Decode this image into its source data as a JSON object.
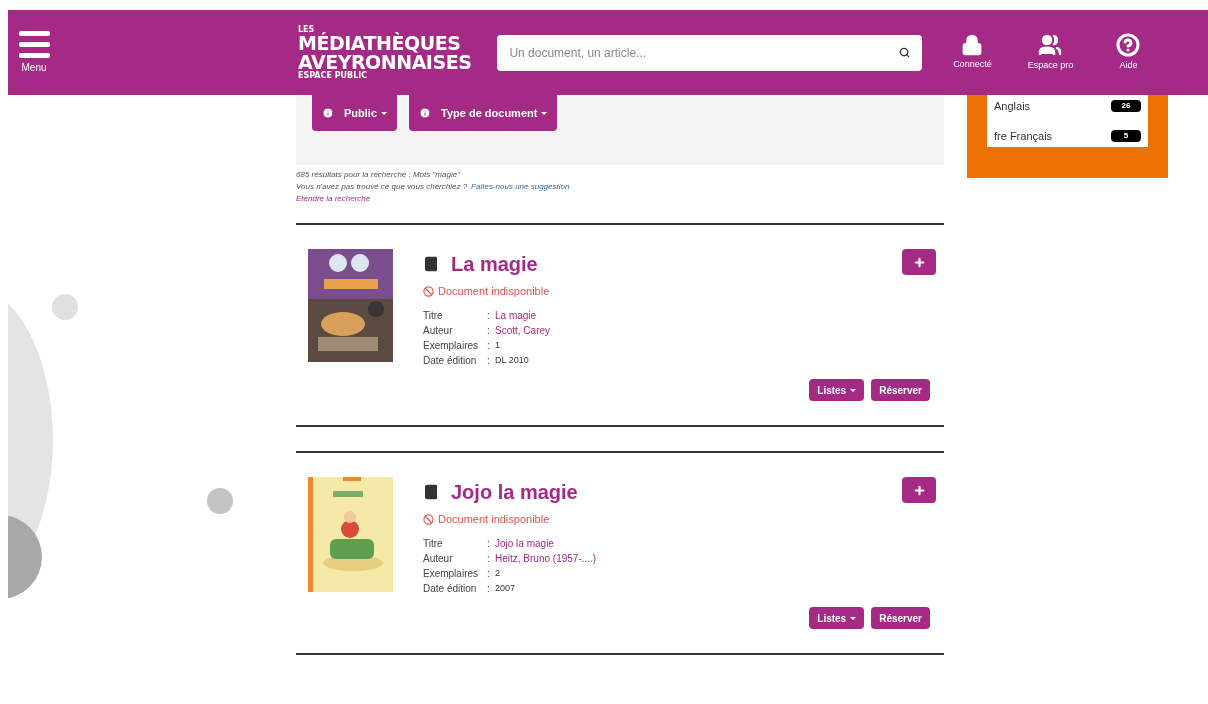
{
  "header": {
    "menu_label": "Menu",
    "logo": {
      "top": "LES",
      "line1": "MÉDIATHÈQUES",
      "line2": "AVEYRONNAISES",
      "bottom": "ESPACE PUBLIC"
    },
    "search": {
      "placeholder": "Un document, un article..."
    },
    "nav": [
      {
        "kind": "lock",
        "label": "Connecté"
      },
      {
        "kind": "users",
        "label": "Espace pro"
      },
      {
        "kind": "help",
        "label": "Aide"
      }
    ]
  },
  "filters": [
    {
      "label": "Public"
    },
    {
      "label": "Type de document"
    }
  ],
  "summary": {
    "count": "685 résultats pour la recherche : Mots \"magie\"",
    "question": "Vous n'avez pas trouvé ce que vous cherchiez ?",
    "suggest_link": "Faites-nous une suggestion",
    "extend_link": "Etendre la recherche"
  },
  "facets": [
    {
      "label": "Anglais",
      "count": "26"
    },
    {
      "label": "fre Français",
      "count": "5"
    }
  ],
  "results": [
    {
      "title": "La magie",
      "status": "Document indisponible",
      "fields": [
        {
          "label": "Titre",
          "separator": ":",
          "value": "La magie",
          "kind": "link"
        },
        {
          "label": "Auteur",
          "separator": ":",
          "value": "Scott, Carey",
          "kind": "link"
        },
        {
          "label": "Exemplaires",
          "separator": ":",
          "value": "1",
          "kind": "text"
        },
        {
          "label": "Date édition",
          "separator": ":",
          "value": "DL 2010",
          "kind": "text"
        }
      ],
      "actions": [
        {
          "label": "Listes",
          "dropdown": true
        },
        {
          "label": "Réserver",
          "dropdown": false
        }
      ]
    },
    {
      "title": "Jojo la magie",
      "status": "Document indisponible",
      "fields": [
        {
          "label": "Titre",
          "separator": ":",
          "value": "Jojo la magie",
          "kind": "link"
        },
        {
          "label": "Auteur",
          "separator": ":",
          "value": "Heitz, Bruno (1957-....)",
          "kind": "link"
        },
        {
          "label": "Exemplaires",
          "separator": ":",
          "value": "2",
          "kind": "text"
        },
        {
          "label": "Date édition",
          "separator": ":",
          "value": "2007",
          "kind": "text"
        }
      ],
      "actions": [
        {
          "label": "Listes",
          "dropdown": true
        },
        {
          "label": "Réserver",
          "dropdown": false
        }
      ]
    }
  ]
}
